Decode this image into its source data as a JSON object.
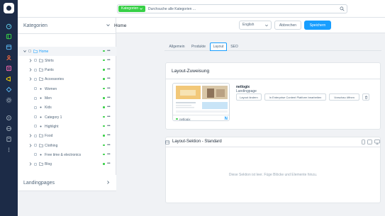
{
  "colors": {
    "sidebar": "#1c2b47",
    "accent": "#189eff",
    "success": "#37d046",
    "text": "#52667a"
  },
  "search": {
    "category": "Kategorien",
    "placeholder": "Durchsuche alle Kategorien ..."
  },
  "nav_icons": [
    "dashboard-icon",
    "catalogue-icon",
    "orders-icon",
    "customers-icon",
    "content-icon",
    "marketing-icon",
    "extensions-icon",
    "settings-icon",
    "sales-channel-icon",
    "storefront-icon",
    "pos-icon",
    "more-icon"
  ],
  "sidebar": {
    "title": "Kategorien",
    "landingpages_label": "Landingpages",
    "tree": [
      {
        "label": "Home",
        "level": 0,
        "expanded": true,
        "folder": true,
        "active": true
      },
      {
        "label": "Shirts",
        "level": 1,
        "expanded": false,
        "folder": true
      },
      {
        "label": "Pants",
        "level": 1,
        "expanded": false,
        "folder": true
      },
      {
        "label": "Accessories",
        "level": 1,
        "expanded": false,
        "folder": true
      },
      {
        "label": "Women",
        "level": 1,
        "folder": false
      },
      {
        "label": "Men",
        "level": 1,
        "folder": false
      },
      {
        "label": "Kids",
        "level": 1,
        "folder": false
      },
      {
        "label": "Category 1",
        "level": 1,
        "folder": false
      },
      {
        "label": "Highlight",
        "level": 1,
        "folder": false
      },
      {
        "label": "Food",
        "level": 1,
        "expanded": false,
        "folder": true
      },
      {
        "label": "Clothing",
        "level": 1,
        "expanded": false,
        "folder": true
      },
      {
        "label": "Free time & electronics",
        "level": 1,
        "folder": false
      },
      {
        "label": "Blog",
        "level": 1,
        "expanded": false,
        "folder": true
      }
    ]
  },
  "header": {
    "title": "Home",
    "language": "English",
    "cancel_label": "Abbrechen",
    "save_label": "Speichern"
  },
  "tabs": [
    "Allgemein",
    "Produkte",
    "Layout",
    "SEO"
  ],
  "active_tab": "Layout",
  "layout_assignment": {
    "title": "Layout-Zuweisung",
    "layout_name": "netlogix",
    "layout_type": "Landingpage",
    "preview_label": "netlogix",
    "preview_badge": "N",
    "btn_change": "Layout ändern",
    "btn_edit": "In Enterprise Content Platform bearbeiten",
    "btn_preview": "Vorschau öffnen"
  },
  "layout_section": {
    "title": "Layout-Sektion - Standard",
    "empty_text": "Diese Sektion ist leer. Füge Blöcke und Elemente hinzu."
  }
}
